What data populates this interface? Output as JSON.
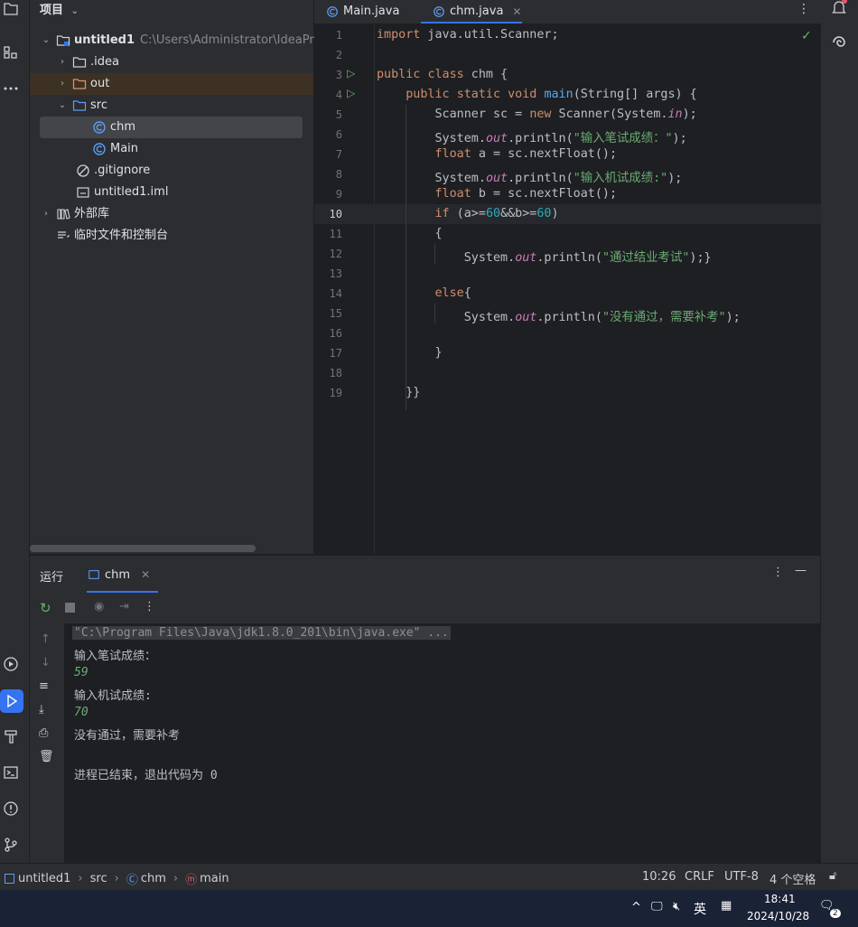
{
  "project": {
    "header": "项目",
    "root_name": "untitled1",
    "root_path": "C:\\Users\\Administrator\\IdeaProjec",
    "items": [
      {
        "label": ".idea"
      },
      {
        "label": "out"
      },
      {
        "label": "src"
      },
      {
        "label": "chm"
      },
      {
        "label": "Main"
      },
      {
        "label": ".gitignore"
      },
      {
        "label": "untitled1.iml"
      },
      {
        "label": "外部库"
      },
      {
        "label": "临时文件和控制台"
      }
    ]
  },
  "tabs": [
    {
      "label": "Main.java"
    },
    {
      "label": "chm.java"
    }
  ],
  "code_lines": [
    {
      "n": "1",
      "text": "import java.util.Scanner;"
    },
    {
      "n": "2",
      "text": ""
    },
    {
      "n": "3",
      "text": "public class chm {"
    },
    {
      "n": "4",
      "text": "    public static void main(String[] args) {"
    },
    {
      "n": "5",
      "text": "        Scanner sc = new Scanner(System.in);"
    },
    {
      "n": "6",
      "text": "        System.out.println(\"输入笔试成绩：\");"
    },
    {
      "n": "7",
      "text": "        float a = sc.nextFloat();"
    },
    {
      "n": "8",
      "text": "        System.out.println(\"输入机试成绩:\");"
    },
    {
      "n": "9",
      "text": "        float b = sc.nextFloat();"
    },
    {
      "n": "10",
      "text": "        if (a>=60&&b>=60)"
    },
    {
      "n": "11",
      "text": "        {"
    },
    {
      "n": "12",
      "text": "            System.out.println(\"通过结业考试\");}"
    },
    {
      "n": "13",
      "text": ""
    },
    {
      "n": "14",
      "text": "        else{"
    },
    {
      "n": "15",
      "text": "            System.out.println(\"没有通过，需要补考\");"
    },
    {
      "n": "16",
      "text": ""
    },
    {
      "n": "17",
      "text": "        }"
    },
    {
      "n": "18",
      "text": ""
    },
    {
      "n": "19",
      "text": "    }}"
    }
  ],
  "run": {
    "title": "运行",
    "tab": "chm",
    "console": [
      "\"C:\\Program Files\\Java\\jdk1.8.0_201\\bin\\java.exe\" ...",
      "输入笔试成绩：",
      "59",
      "输入机试成绩:",
      "70",
      "没有通过，需要补考",
      "",
      "进程已结束，退出代码为 0"
    ]
  },
  "status": {
    "breadcrumb": [
      "untitled1",
      "src",
      "chm",
      "main"
    ],
    "position": "10:26",
    "line_sep": "CRLF",
    "encoding": "UTF-8",
    "indent": "4 个空格"
  },
  "taskbar": {
    "ime": "英",
    "time": "18:41",
    "date": "2024/10/28",
    "notif_count": "2"
  },
  "colors": {
    "accent": "#3574f0",
    "run_green": "#5fb865"
  }
}
